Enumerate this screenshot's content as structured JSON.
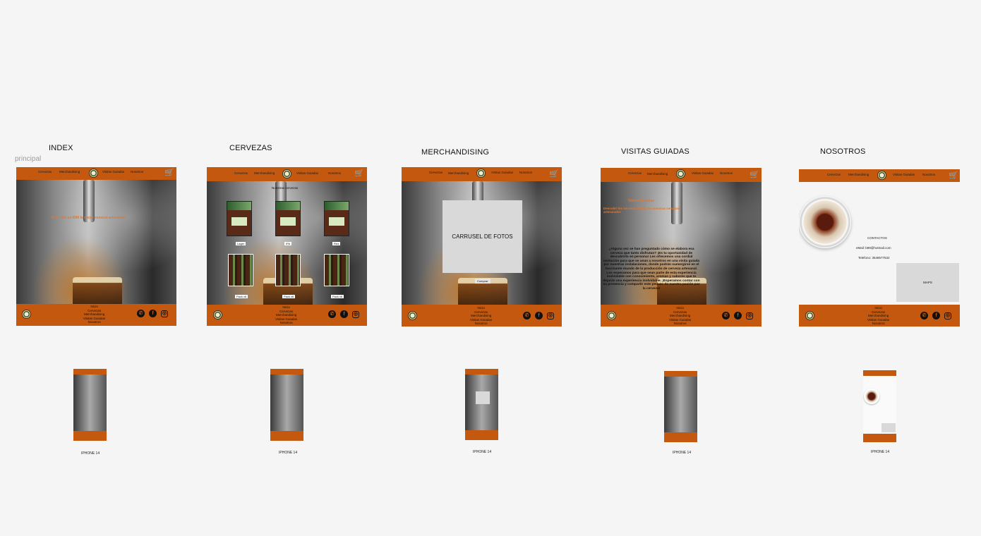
{
  "canvas": {
    "page_label": "principal"
  },
  "frames": {
    "index": {
      "title": "INDEX"
    },
    "cervezas": {
      "title": "CERVEZAS"
    },
    "merchandising": {
      "title": "MERCHANDISING"
    },
    "visitas": {
      "title": "VISITAS GUIADAS"
    },
    "nosotros": {
      "title": "NOSOTROS"
    }
  },
  "nav": {
    "cervezas": "Cervezas",
    "merchandising": "Merchandising",
    "visitas": "Visitas Guiadas",
    "nosotros": "Nosotros"
  },
  "footer": {
    "links": [
      "Inicio",
      "Cervezas",
      "Merchandising",
      "Visitas Guiadas",
      "Nosotros"
    ]
  },
  "index_page": {
    "hero_text": "Descubrí en B99 la mejor cerveza artesanal!"
  },
  "cervezas_page": {
    "heading": "Nuestras cervezas",
    "captions": [
      "Lager",
      "IPA",
      "Red",
      "Pack x6",
      "Pack x6",
      "Pack x6"
    ]
  },
  "merch_page": {
    "carousel_label": "CARRUSEL DE FOTOS",
    "button": "Comprar"
  },
  "visitas_page": {
    "tag": "Visitas Guiadas",
    "intro": "Descubrí los secretos detrás de nuestras cervezas artesanales",
    "body": "¿Alguna vez se han preguntado cómo se elabora esa cerveza que tanto disfrutan? ¡Es tu oportunidad de descubrirlo en persona! Les ofrecemos una cordial invitación para que se unan a nosotros en una visita guiada por nuestras instalaciones, donde podrán sumergirse en el fascinante mundo de la producción de cerveza artesanal. Los esperamos para que sean parte de esta experiencia inolvidable con conocimiento, aromas y sabores que te dejarán una experiencia inolvidable. ¡Esperamos contar con su presencia y compartir este pedazo de nuestra pasión por la cerveza!"
  },
  "nosotros_page": {
    "contact_title": "CONTACTOS",
    "email": "eMail: b99@hotmail.com",
    "phone": "Telefono: 3548577532",
    "maps": "MAPS"
  },
  "mobile": {
    "device_label": "IPHONE 14"
  },
  "colors": {
    "brand": "#c4580f",
    "canvas": "#f5f5f5",
    "placeholder": "#d9d9d9"
  }
}
